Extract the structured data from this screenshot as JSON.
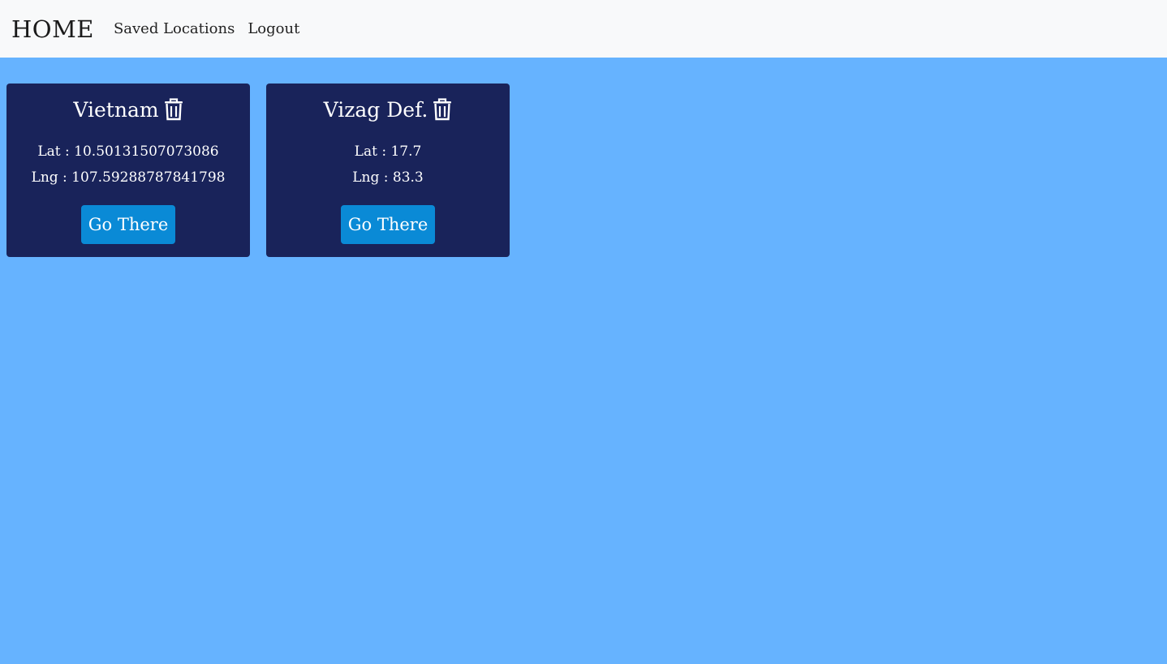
{
  "nav": {
    "brand": "HOME",
    "links": [
      "Saved Locations",
      "Logout"
    ]
  },
  "locations": [
    {
      "name": "Vietnam",
      "lat_label": "Lat : 10.50131507073086",
      "lng_label": "Lng : 107.59288787841798",
      "button": "Go There"
    },
    {
      "name": "Vizag Def.",
      "lat_label": "Lat : 17.7",
      "lng_label": "Lng : 83.3",
      "button": "Go There"
    }
  ],
  "colors": {
    "page_background": "#66b3ff",
    "card_background": "#19235a",
    "button": "#0a8ad6",
    "navbar": "#f8f9fa"
  },
  "icons": [
    "trash-icon"
  ]
}
